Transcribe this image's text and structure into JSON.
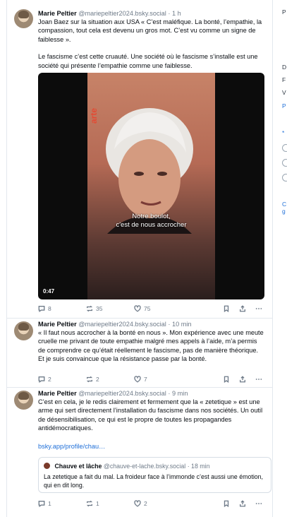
{
  "posts": [
    {
      "author": "Marie Peltier",
      "handle": "@mariepeltier2024.bsky.social",
      "time": "· 1 h",
      "text1": "Joan Baez sur la situation aux USA  « C’est maléfique. La bonté, l’empathie, la compassion, tout cela est devenu un gros mot. C’est vu comme un signe de faiblesse ».",
      "text2": "Le fascisme c’est cette cruauté. Une société où le fascisme s’installe est une société qui présente l’empathie comme une faiblesse.",
      "video": {
        "brand": "arte",
        "subtitle1": "Notre boulot,",
        "subtitle2": "c'est de nous accrocher",
        "duration": "0:47"
      },
      "replies": "8",
      "reposts": "35",
      "likes": "75"
    },
    {
      "author": "Marie Peltier",
      "handle": "@mariepeltier2024.bsky.social",
      "time": "· 10 min",
      "text": "« Il faut nous accrocher à la bonté en nous ». Mon expérience avec une meute cruelle me privant de toute empathie malgré mes appels à l’aide, m’a permis de comprendre ce qu’était réellement le fascisme, pas de manière théorique. Et je suis convaincue que la résistance passe par la bonté.",
      "replies": "2",
      "reposts": "2",
      "likes": "7"
    },
    {
      "author": "Marie Peltier",
      "handle": "@mariepeltier2024.bsky.social",
      "time": "· 9 min",
      "text": "C’est en cela, je le redis clairement et fermement que la « zetetique » est une arme qui sert directement l’installation du fascisme dans nos sociétés. Un outil de désensibilisation, ce qui est le propre de toutes les propagandes antidémocratiques.",
      "link": "bsky.app/profile/chau…",
      "quote": {
        "author": "Chauve et lâche",
        "handle": "@chauve-et-lache.bsky.social",
        "time": "· 18 min",
        "text": "La zetetique a fait du mal. La froideur face à l’immonde c’est aussi une émotion, qui en dit long."
      },
      "replies": "1",
      "reposts": "1",
      "likes": "2"
    }
  ],
  "right_column": {
    "label_p_top": "P",
    "label_d": "D",
    "label_f": "F",
    "label_v": "V",
    "link_p": "P",
    "label_star": "*",
    "link_c": "C",
    "link_g": "g"
  },
  "colors": {
    "accent": "#1f6fd8",
    "muted": "#6f7b89",
    "border": "#e3e8ee"
  }
}
